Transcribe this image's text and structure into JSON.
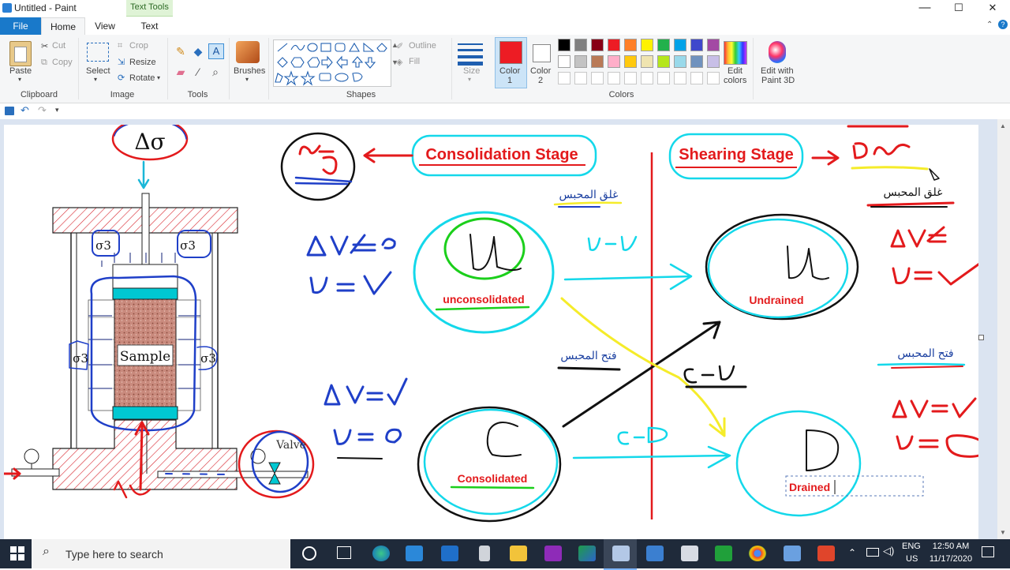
{
  "window": {
    "title": "Untitled - Paint",
    "context_tab": "Text Tools",
    "minimize": "—",
    "maximize": "☐",
    "close": "✕"
  },
  "tabs": {
    "file": "File",
    "home": "Home",
    "view": "View",
    "text": "Text"
  },
  "ribbon": {
    "clipboard": {
      "paste": "Paste",
      "cut": "Cut",
      "copy": "Copy",
      "label": "Clipboard"
    },
    "image": {
      "select": "Select",
      "crop": "Crop",
      "resize": "Resize",
      "rotate": "Rotate",
      "label": "Image"
    },
    "tools": {
      "label": "Tools"
    },
    "brushes": {
      "label": "Brushes"
    },
    "shapes": {
      "outline": "Outline",
      "fill": "Fill",
      "label": "Shapes"
    },
    "size": {
      "label": "Size"
    },
    "colors": {
      "color1": "Color\n1",
      "color1_a": "Color",
      "color1_b": "1",
      "color2_a": "Color",
      "color2_b": "2",
      "edit": "Edit",
      "edit2": "colors",
      "paint3d_a": "Edit with",
      "paint3d_b": "Paint 3D",
      "label": "Colors",
      "color1_value": "#ed1c24",
      "color2_value": "#ffffff",
      "palette_row1": [
        "#000000",
        "#7f7f7f",
        "#880015",
        "#ed1c24",
        "#ff7f27",
        "#fff200",
        "#22b14c",
        "#00a2e8",
        "#3f48cc",
        "#a349a4"
      ],
      "palette_row2": [
        "#ffffff",
        "#c3c3c3",
        "#b97a57",
        "#ffaec9",
        "#ffc90e",
        "#efe4b0",
        "#b5e61d",
        "#99d9ea",
        "#7092be",
        "#c8bfe7"
      ]
    }
  },
  "canvas": {
    "delta_sigma": "Δσ",
    "sigma3": "σ3",
    "sample": "Sample",
    "valve": "Valve",
    "consolidation_stage": "Consolidation Stage",
    "shearing_stage": "Shearing Stage",
    "arabic_close": "غلق المحبس",
    "arabic_open": "فتح المحبس",
    "unconsolidated": "unconsolidated",
    "consolidated": "Consolidated",
    "undrained": "Undrained",
    "drained": "Drained"
  },
  "taskbar": {
    "search_placeholder": "Type here to search",
    "lang": "ENG",
    "region": "US",
    "time": "12:50 AM",
    "date": "11/17/2020"
  }
}
